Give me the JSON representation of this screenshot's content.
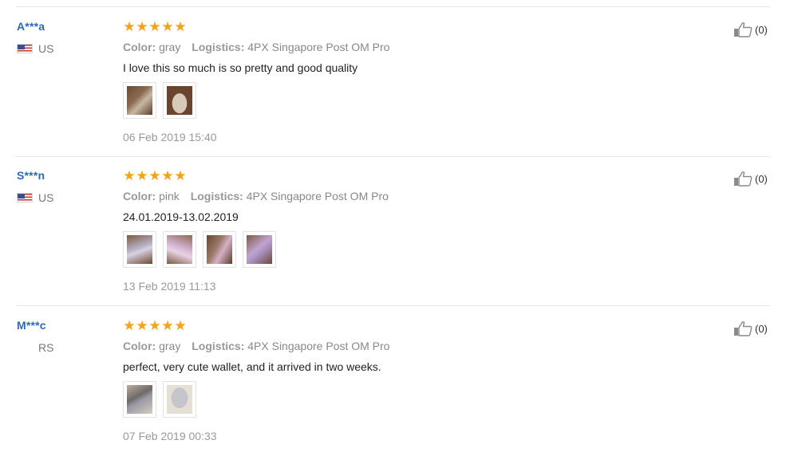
{
  "labels": {
    "color": "Color:",
    "logistics": "Logistics:"
  },
  "colors": {
    "name": "#2a6ab8",
    "star": "#f4a311",
    "divider": "#e6e6e6"
  },
  "reviews": [
    {
      "buyer": "A***a",
      "country": "US",
      "has_flag": true,
      "rating": 5,
      "color": "gray",
      "logistics": "4PX Singapore Post OM Pro",
      "comment": "I love this so much is so pretty and good quality",
      "photo_count": 2,
      "date": "06 Feb 2019 15:40",
      "helpful": "(0)"
    },
    {
      "buyer": "S***n",
      "country": "US",
      "has_flag": true,
      "rating": 5,
      "color": "pink",
      "logistics": "4PX Singapore Post OM Pro",
      "comment": "24.01.2019-13.02.2019",
      "photo_count": 4,
      "date": "13 Feb 2019 11:13",
      "helpful": "(0)"
    },
    {
      "buyer": "M***c",
      "country": "RS",
      "has_flag": false,
      "rating": 5,
      "color": "gray",
      "logistics": "4PX Singapore Post OM Pro",
      "comment": "perfect, very cute wallet, and it arrived in two weeks.",
      "photo_count": 2,
      "date": "07 Feb 2019 00:33",
      "helpful": "(0)"
    }
  ]
}
